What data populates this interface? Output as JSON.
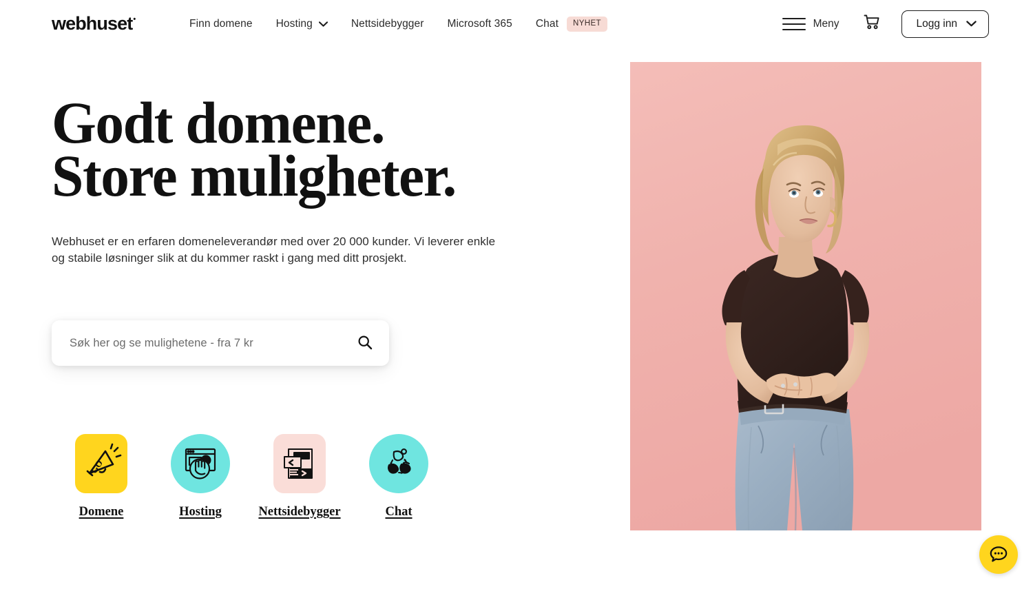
{
  "header": {
    "logo": {
      "text": "webhuset",
      "mark": "®"
    },
    "nav": [
      {
        "label": "Finn domene",
        "has_caret": false,
        "badge": null
      },
      {
        "label": "Hosting",
        "has_caret": true,
        "badge": null
      },
      {
        "label": "Nettsidebygger",
        "has_caret": false,
        "badge": null
      },
      {
        "label": "Microsoft 365",
        "has_caret": false,
        "badge": null
      },
      {
        "label": "Chat",
        "has_caret": false,
        "badge": "NYHET"
      }
    ],
    "menu_label": "Meny",
    "cart_icon": "shopping-cart-icon",
    "menu_icon": "hamburger-menu-icon",
    "login_label": "Logg inn",
    "login_caret_icon": "chevron-down-icon"
  },
  "hero": {
    "title": "Godt domene.\nStore muligheter.",
    "subtitle": "Webhuset er en erfaren domeneleverandør med over 20 000 kunder. Vi leverer enkle og stabile løsninger slik at du kommer raskt i gang med ditt prosjekt.",
    "photo_alt": "Kvinne med blondt hår i mørk t-skjorte mot rosa bakgrunn"
  },
  "search": {
    "placeholder": "Søk her og se mulighetene - fra 7 kr",
    "value": "",
    "icon": "search-icon"
  },
  "services": [
    {
      "label": "Domene",
      "icon": "megaphone-go-icon",
      "shape": "square",
      "bg": "#FFD51E"
    },
    {
      "label": "Hosting",
      "icon": "browser-click-icon",
      "shape": "circle",
      "bg": "#6FE5E0"
    },
    {
      "label": "Nettsidebygger",
      "icon": "code-layout-icon",
      "shape": "square",
      "bg": "#FADDD8"
    },
    {
      "label": "Chat",
      "icon": "people-chat-icon",
      "shape": "circle",
      "bg": "#6FE5E0"
    }
  ],
  "chat_fab": {
    "icon": "chat-bubble-icon",
    "bg": "#FFD51E",
    "label": "Chat"
  },
  "colors": {
    "accent_yellow": "#FFD51E",
    "accent_cyan": "#6FE5E0",
    "accent_pink": "#FADDD8",
    "badge_pink": "#F7DBD5",
    "text_dark": "#111111",
    "photo_bg_pink": "#F0B3AE"
  }
}
